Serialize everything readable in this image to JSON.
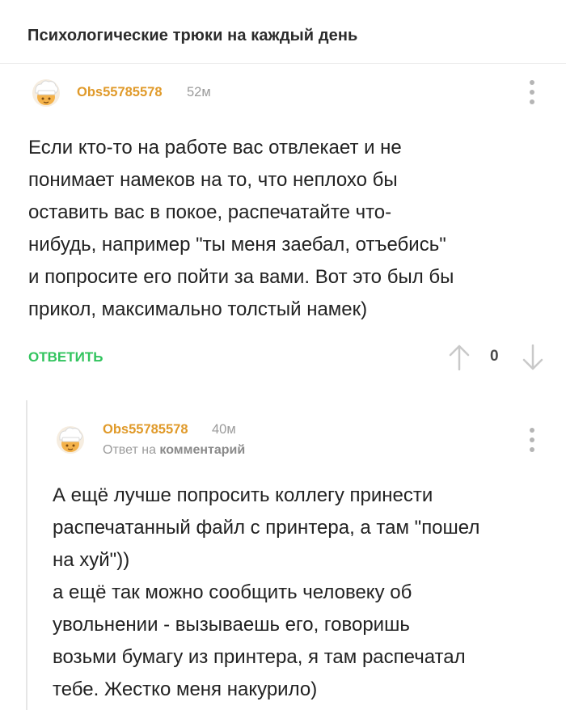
{
  "post": {
    "title": "Психологические трюки на каждый день"
  },
  "comment": {
    "username": "Obs55785578",
    "time": "52м",
    "text": "Если кто-то на работе вас отвлекает и не\nпонимает намеков на то, что неплохо бы\nоставить вас в покое, распечатайте что-\nнибудь, например \"ты меня заебал, отъебись\"\nи попросите его пойти за вами. Вот это был бы\nприкол, максимально толстый намек)",
    "reply_label": "ОТВЕТИТЬ",
    "rating": "0"
  },
  "reply": {
    "username": "Obs55785578",
    "time": "40м",
    "reply_to_prefix": "Ответ на",
    "reply_to_link": "комментарий",
    "text": "А ещё лучше попросить коллегу принести\nраспечатанный файл с принтера, а там \"пошел\nна хуй\"))\nа ещё так можно сообщить человеку об\nувольнении - вызываешь его, говоришь\nвозьми бумагу из принтера, я там распечатал\nтебе. Жестко меня накурило)"
  },
  "colors": {
    "accent_username": "#e09a2a",
    "reply_button": "#32c45e",
    "icon_gray": "#b5b5b5"
  },
  "icons": {
    "avatar": "chef-hat-avatar-icon",
    "menu": "more-vertical-icon",
    "upvote": "arrow-up-icon",
    "downvote": "arrow-down-icon"
  }
}
